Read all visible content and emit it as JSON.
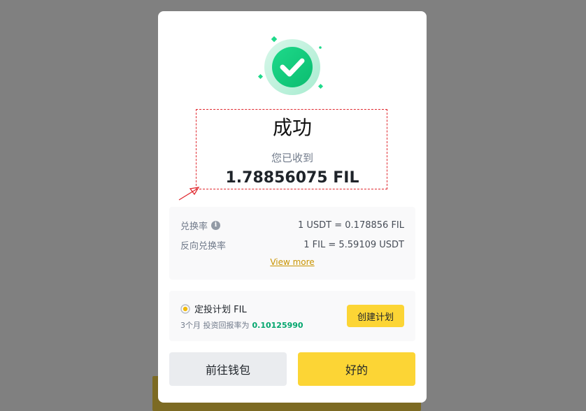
{
  "dialog": {
    "title": "成功",
    "received_label": "您已收到",
    "amount": "1.78856075 FIL"
  },
  "rates": {
    "exchange_rate_label": "兑换率",
    "exchange_rate_value": "1 USDT = 0.178856 FIL",
    "reverse_rate_label": "反向兑换率",
    "reverse_rate_value": "1 FIL = 5.59109 USDT",
    "view_more": "View more"
  },
  "plan": {
    "title": "定投计划 FIL",
    "subtitle": "3个月 投资回报率为",
    "return_rate": "0.10125990",
    "create_button": "创建计划"
  },
  "actions": {
    "wallet_button": "前往钱包",
    "ok_button": "好的"
  },
  "colors": {
    "brand_yellow": "#fcd535",
    "success_green": "#03a66d",
    "highlight_red": "#e0282e"
  },
  "icons": {
    "success": "check-circle-icon",
    "info": "info-icon",
    "plan": "recurring-plan-icon",
    "annotation": "arrow-icon"
  }
}
